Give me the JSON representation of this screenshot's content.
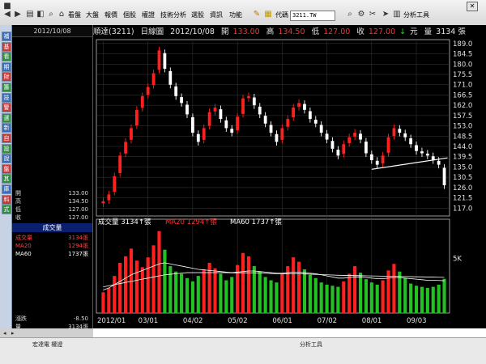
{
  "toolbar": {
    "menu": [
      "看盤",
      "大盤",
      "報價",
      "個股",
      "權證",
      "技術分析",
      "選股",
      "資訊",
      "功能"
    ],
    "code_label": "代碼",
    "code_value": "3211.TW",
    "tools_label": "分析工具"
  },
  "left_strip": {
    "buttons": [
      {
        "label": "補",
        "color": "#3b6cb7"
      },
      {
        "label": "基",
        "color": "#c23b3b"
      },
      {
        "label": "看",
        "color": "#2f8f3f"
      },
      {
        "label": "期",
        "color": "#3b6cb7"
      },
      {
        "label": "財",
        "color": "#c23b3b"
      },
      {
        "label": "籌",
        "color": "#2f8f3f"
      },
      {
        "label": "技",
        "color": "#3b6cb7"
      },
      {
        "label": "警",
        "color": "#c23b3b"
      },
      {
        "label": "選",
        "color": "#2f8f3f"
      },
      {
        "label": "新",
        "color": "#3b6cb7"
      },
      {
        "label": "自",
        "color": "#c23b3b"
      },
      {
        "label": "設",
        "color": "#2f8f3f"
      },
      {
        "label": "說",
        "color": "#3b6cb7"
      },
      {
        "label": "盤",
        "color": "#c23b3b"
      },
      {
        "label": "其",
        "color": "#2f8f3f"
      },
      {
        "label": "庫",
        "color": "#3b6cb7"
      },
      {
        "label": "料",
        "color": "#c23b3b"
      },
      {
        "label": "式",
        "color": "#2f8f3f"
      }
    ]
  },
  "info_panel": {
    "date": "2012/10/08",
    "quotes": [
      {
        "label": "開",
        "value": "133.00"
      },
      {
        "label": "高",
        "value": "134.50"
      },
      {
        "label": "低",
        "value": "127.00"
      },
      {
        "label": "收",
        "value": "127.00"
      }
    ],
    "volume_header": "成交量",
    "volume_rows": [
      {
        "label": "成交量",
        "value": "3134張",
        "color": "#ff4040"
      },
      {
        "label": "MA20",
        "value": "1294張",
        "color": "#ff4040"
      },
      {
        "label": "MA60",
        "value": "1737張",
        "color": "#ffffff"
      }
    ],
    "change_label": "漲跌",
    "change_value": "-8.50",
    "amount_label": "量",
    "amount_value": "3134張"
  },
  "chart_header": {
    "symbol": "順達(3211)",
    "period": "日線圖",
    "date": "2012/10/08",
    "open_label": "開",
    "open": "133.00",
    "high_label": "高",
    "high": "134.50",
    "low_label": "低",
    "low": "127.00",
    "close_label": "收",
    "close": "127.00",
    "arrow": "↓",
    "unit": "元",
    "vol_label": "量",
    "vol": "3134 張"
  },
  "volume_header": {
    "vol_label": "成交量",
    "vol": "3134",
    "ma20_label": "MA20",
    "ma20": "1294",
    "ma60_label": "MA60",
    "ma60": "1737",
    "unit": "張"
  },
  "status_bar": {
    "left_text": "宏達電 權證",
    "right_text": "分析工具"
  },
  "colors": {
    "up": "#ff2020",
    "down": "#ffffff",
    "vol_up": "#ff2020",
    "vol_down": "#22c222",
    "ma20": "#ffffff",
    "ma60": "#ffffff",
    "grid": "#3a3a3a"
  },
  "chart_data": {
    "type": "candlestick",
    "ylim": [
      115.0,
      190.0
    ],
    "y_ticks": [
      "189.0",
      "184.5",
      "180.0",
      "175.5",
      "171.0",
      "166.5",
      "162.0",
      "157.5",
      "153.0",
      "148.5",
      "144.0",
      "139.5",
      "135.0",
      "130.5",
      "126.0",
      "121.5",
      "117.0"
    ],
    "x_ticks": [
      "2012/01",
      "03/01",
      "04/02",
      "05/02",
      "06/01",
      "07/02",
      "08/01",
      "09/03"
    ],
    "volume_tick": "5K",
    "volume_ylim": [
      0,
      8000
    ],
    "trendline": {
      "from": {
        "x": "07/27",
        "y": 134.0
      },
      "to": {
        "x": "10/08",
        "y": 139.0
      }
    },
    "series": [
      {
        "name": "Price",
        "values": [
          120,
          123,
          131,
          140,
          146,
          152,
          160,
          166,
          170,
          176,
          186,
          178,
          171,
          166,
          163,
          158,
          150,
          146,
          152,
          159,
          161,
          156,
          152,
          150,
          157,
          165,
          166,
          162,
          158,
          154,
          150,
          146,
          152,
          156,
          161,
          163,
          160,
          156,
          154,
          150,
          147,
          143,
          140,
          145,
          148,
          150,
          147,
          141,
          138,
          136,
          140,
          148,
          152,
          150,
          148,
          145,
          142,
          141,
          140,
          138,
          136,
          127
        ]
      },
      {
        "name": "成交量",
        "values": [
          1900,
          2300,
          3400,
          4600,
          5200,
          5900,
          4800,
          4200,
          5100,
          6200,
          7500,
          5800,
          4300,
          3800,
          3600,
          3200,
          2900,
          3400,
          4000,
          4600,
          4100,
          3600,
          3000,
          3300,
          4400,
          5500,
          5200,
          4300,
          3800,
          3300,
          3000,
          2800,
          3600,
          4300,
          5100,
          4700,
          4000,
          3500,
          3200,
          2800,
          2600,
          2500,
          2400,
          2900,
          3600,
          4300,
          3700,
          3100,
          2800,
          2600,
          3000,
          3900,
          4500,
          3800,
          3200,
          2700,
          2500,
          2400,
          2300,
          2400,
          2600,
          3134
        ]
      },
      {
        "name": "MA20",
        "values": [
          2100,
          2300,
          2600,
          2900,
          3200,
          3500,
          3700,
          3900,
          4100,
          4300,
          4500,
          4600,
          4500,
          4400,
          4300,
          4200,
          4100,
          4000,
          3950,
          3900,
          3850,
          3800,
          3750,
          3700,
          3750,
          3800,
          3850,
          3850,
          3800,
          3750,
          3700,
          3650,
          3650,
          3700,
          3750,
          3750,
          3700,
          3650,
          3600,
          3500,
          3400,
          3300,
          3200,
          3200,
          3250,
          3300,
          3300,
          3250,
          3200,
          3150,
          3150,
          3200,
          3250,
          3250,
          3200,
          3150,
          3100,
          3050,
          3000,
          3000,
          2980,
          2960
        ]
      },
      {
        "name": "MA60",
        "values": [
          2400,
          2500,
          2600,
          2700,
          2800,
          2900,
          3000,
          3100,
          3200,
          3300,
          3400,
          3500,
          3550,
          3600,
          3650,
          3700,
          3700,
          3700,
          3700,
          3700,
          3700,
          3700,
          3700,
          3680,
          3680,
          3680,
          3680,
          3680,
          3660,
          3640,
          3620,
          3600,
          3600,
          3600,
          3600,
          3600,
          3580,
          3560,
          3540,
          3520,
          3500,
          3480,
          3460,
          3450,
          3440,
          3430,
          3420,
          3410,
          3400,
          3390,
          3380,
          3370,
          3360,
          3350,
          3340,
          3330,
          3320,
          3310,
          3300,
          3290,
          3280,
          3270
        ]
      }
    ]
  }
}
